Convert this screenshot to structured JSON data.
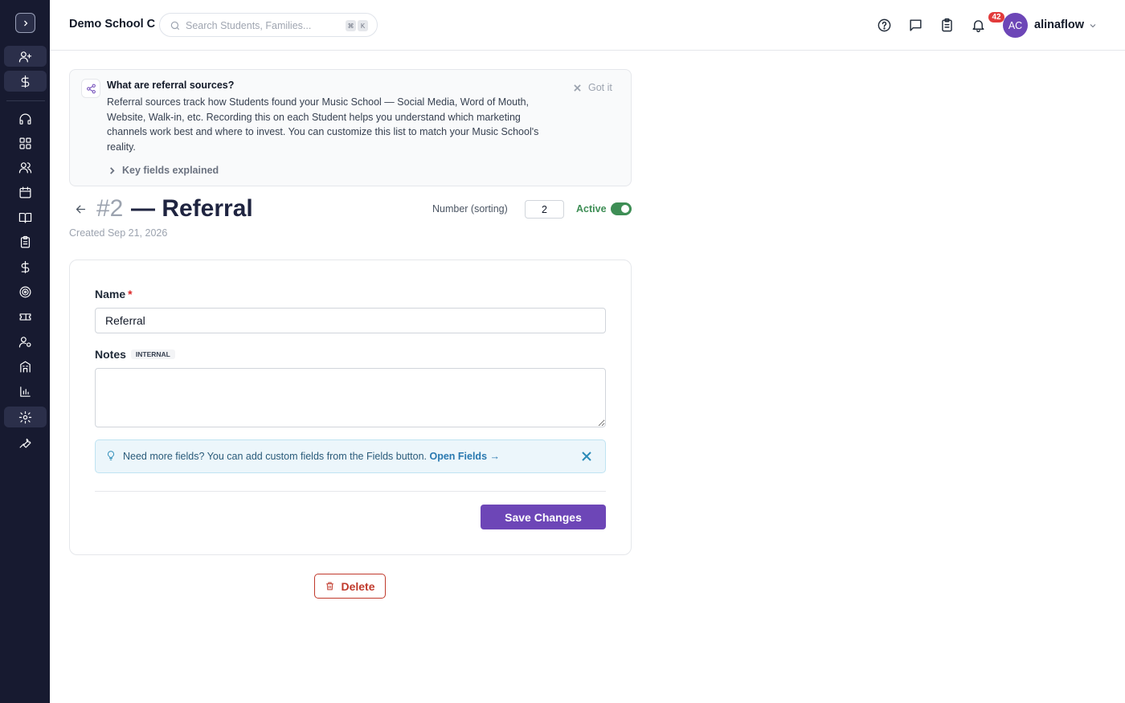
{
  "header": {
    "school_name": "Demo School C",
    "search_placeholder": "Search Students, Families...",
    "shortcut_keys": [
      "⌘",
      "K"
    ],
    "notification_count": "42",
    "user_initials": "AC",
    "username": "alinaflow"
  },
  "sidebar": {
    "items": [
      {
        "icon": "user-plus-icon"
      },
      {
        "icon": "dollar-icon"
      },
      {
        "icon": "headset-icon"
      },
      {
        "icon": "dashboard-icon"
      },
      {
        "icon": "users-icon"
      },
      {
        "icon": "calendar-icon"
      },
      {
        "icon": "book-open-icon"
      },
      {
        "icon": "clipboard-icon"
      },
      {
        "icon": "dollar-icon"
      },
      {
        "icon": "target-icon"
      },
      {
        "icon": "ticket-icon"
      },
      {
        "icon": "user-cog-icon"
      },
      {
        "icon": "building-icon"
      },
      {
        "icon": "bar-chart-icon"
      },
      {
        "icon": "settings-icon",
        "active": true
      },
      {
        "icon": "wrench-icon"
      }
    ]
  },
  "info": {
    "title": "What are referral sources?",
    "body": "Referral sources track how Students found your Music School — Social Media, Word of Mouth, Website, Walk-in, etc. Recording this on each Student helps you understand which marketing channels work best and where to invest. You can customize this list to match your Music School's reality.",
    "dismiss_label": "Got it",
    "key_fields_label": "Key fields explained"
  },
  "record": {
    "number": "#2",
    "title": "— Referral",
    "created": "Created Sep 21, 2026",
    "sorting_label": "Number (sorting)",
    "sorting_value": "2",
    "active_label": "Active",
    "active": true
  },
  "form": {
    "name_label": "Name",
    "required_mark": "*",
    "name_value": "Referral",
    "notes_label": "Notes",
    "notes_badge": "INTERNAL",
    "notes_value": "",
    "tip_text": "Need more fields? You can add custom fields from the Fields button.",
    "tip_link": "Open Fields →",
    "save_label": "Save Changes"
  },
  "actions": {
    "delete_label": "Delete"
  },
  "colors": {
    "sidebar_bg": "#171a30",
    "accent": "#6d46b7",
    "active_green": "#3e8e55",
    "danger": "#c0392b",
    "badge": "#e23b3b"
  }
}
